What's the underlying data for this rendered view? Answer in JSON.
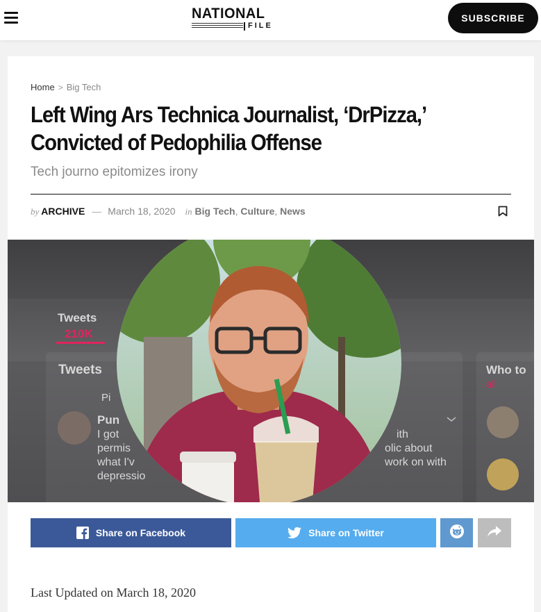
{
  "header": {
    "logo_top": "NATIONAL",
    "logo_bottom": "FILE",
    "subscribe_label": "SUBSCRIBE"
  },
  "breadcrumb": {
    "home": "Home",
    "separator": ">",
    "current": "Big Tech"
  },
  "article": {
    "title": "Left Wing Ars Technica Journalist, ‘DrPizza,’ Convicted of Pedophilia Offense",
    "subtitle": "Tech journo epitomizes irony",
    "meta": {
      "by": "by",
      "author": "ARCHIVE",
      "dash": "—",
      "date": "March 18, 2020",
      "in": "in",
      "categories": [
        "Big Tech",
        "Culture",
        "News"
      ]
    },
    "last_updated": "Last Updated on March 18, 2020"
  },
  "hero_image": {
    "background_text": {
      "tweets_tab": "Tweets",
      "tweets_count": "210K",
      "tweets_heading": "Tweets",
      "pinned": "Pi",
      "name": "Pun",
      "line1": "I got",
      "line2": "permis",
      "line3": "what I'v",
      "line4": "depressio",
      "right1": "ith",
      "right2": "olic about",
      "right3": "work on with",
      "who_to": "Who to",
      "all": "all"
    }
  },
  "share": {
    "facebook_label": "Share on Facebook",
    "twitter_label": "Share on Twitter"
  },
  "colors": {
    "facebook": "#3b5998",
    "twitter": "#55acee",
    "reddit": "#5f99cf",
    "more": "#bdbdbd",
    "subscribe_bg": "#0d0d0d"
  }
}
